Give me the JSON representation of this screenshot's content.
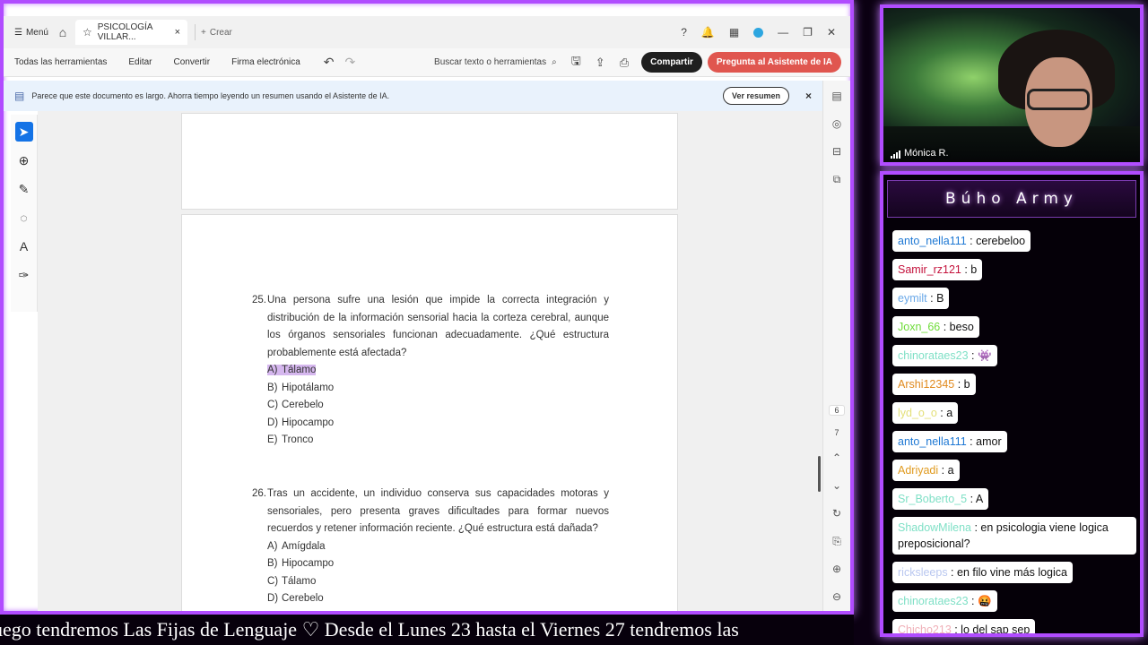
{
  "acrobat": {
    "tabbar": {
      "menu_label": "Menú",
      "tab_title": "PSICOLOGÍA VILLAR...",
      "new_label": "Crear"
    },
    "toolbar": {
      "all_tools": "Todas las herramientas",
      "edit": "Editar",
      "convert": "Convertir",
      "esign": "Firma electrónica",
      "search_label": "Buscar texto o herramientas",
      "share_button": "Compartir",
      "ai_button": "Pregunta al Asistente de IA"
    },
    "banner": {
      "message": "Parece que este documento es largo. Ahorra tiempo leyendo un resumen usando el Asistente de IA.",
      "button": "Ver resumen",
      "close": "×"
    },
    "right_rail": {
      "page_numbers": [
        "6",
        "7"
      ]
    },
    "document": {
      "q25": {
        "number": "25.",
        "text": "Una persona sufre una lesión que impide la correcta integración y distribución de la información sensorial hacia la corteza cerebral, aunque los órganos sensoriales funcionan adecuadamente. ¿Qué estructura probablemente está afectada?",
        "options": [
          {
            "letter": "A)",
            "label": "Tálamo"
          },
          {
            "letter": "B)",
            "label": "Hipotálamo"
          },
          {
            "letter": "C)",
            "label": "Cerebelo"
          },
          {
            "letter": "D)",
            "label": "Hipocampo"
          },
          {
            "letter": "E)",
            "label": "Tronco"
          }
        ]
      },
      "q26": {
        "number": "26.",
        "text": "Tras un accidente, un individuo conserva sus capacidades motoras y sensoriales, pero presenta graves dificultades para formar nuevos recuerdos y retener información reciente. ¿Qué estructura está dañada?",
        "options": [
          {
            "letter": "A)",
            "label": "Amígdala"
          },
          {
            "letter": "B)",
            "label": "Hipocampo"
          },
          {
            "letter": "C)",
            "label": "Tálamo"
          },
          {
            "letter": "D)",
            "label": "Cerebelo"
          }
        ]
      }
    }
  },
  "webcam": {
    "name": "Mónica R."
  },
  "chat": {
    "title": "Búho Army",
    "messages": [
      {
        "user": "anto_nella111",
        "text": "cerebeloo",
        "color": "#1e78d4"
      },
      {
        "user": "Samir_rz121",
        "text": "b",
        "color": "#c4123c"
      },
      {
        "user": "eymilt",
        "text": "B",
        "color": "#6aa8e8"
      },
      {
        "user": "Joxn_66",
        "text": "beso",
        "color": "#6fdc3a"
      },
      {
        "user": "chinorataes23",
        "text": "👾",
        "color": "#7fe0c6"
      },
      {
        "user": "Arshi12345",
        "text": "b",
        "color": "#e08a1e"
      },
      {
        "user": "lyd_o_o",
        "text": "a",
        "color": "#e4e07a"
      },
      {
        "user": "anto_nella111",
        "text": "amor",
        "color": "#1e78d4"
      },
      {
        "user": "Adriyadi",
        "text": "a",
        "color": "#e09a1e"
      },
      {
        "user": "Sr_Boberto_5",
        "text": "A",
        "color": "#7fe0c6"
      },
      {
        "user": "ShadowMilena",
        "text": "en psicologia viene logica preposicional?",
        "color": "#7fe0c6"
      },
      {
        "user": "ricksleeps",
        "text": "en filo vine más logica",
        "color": "#b9c7f0"
      },
      {
        "user": "chinorataes23",
        "text": "🤬",
        "color": "#7fe0c6"
      },
      {
        "user": "Chicho213",
        "text": "lo del sap sep",
        "color": "#f0b0b8"
      }
    ]
  },
  "ticker": {
    "text": "uego tendremos Las Fijas de Lenguaje     ♡     Desde el Lunes 23 hasta el Viernes 27 tendremos las"
  }
}
